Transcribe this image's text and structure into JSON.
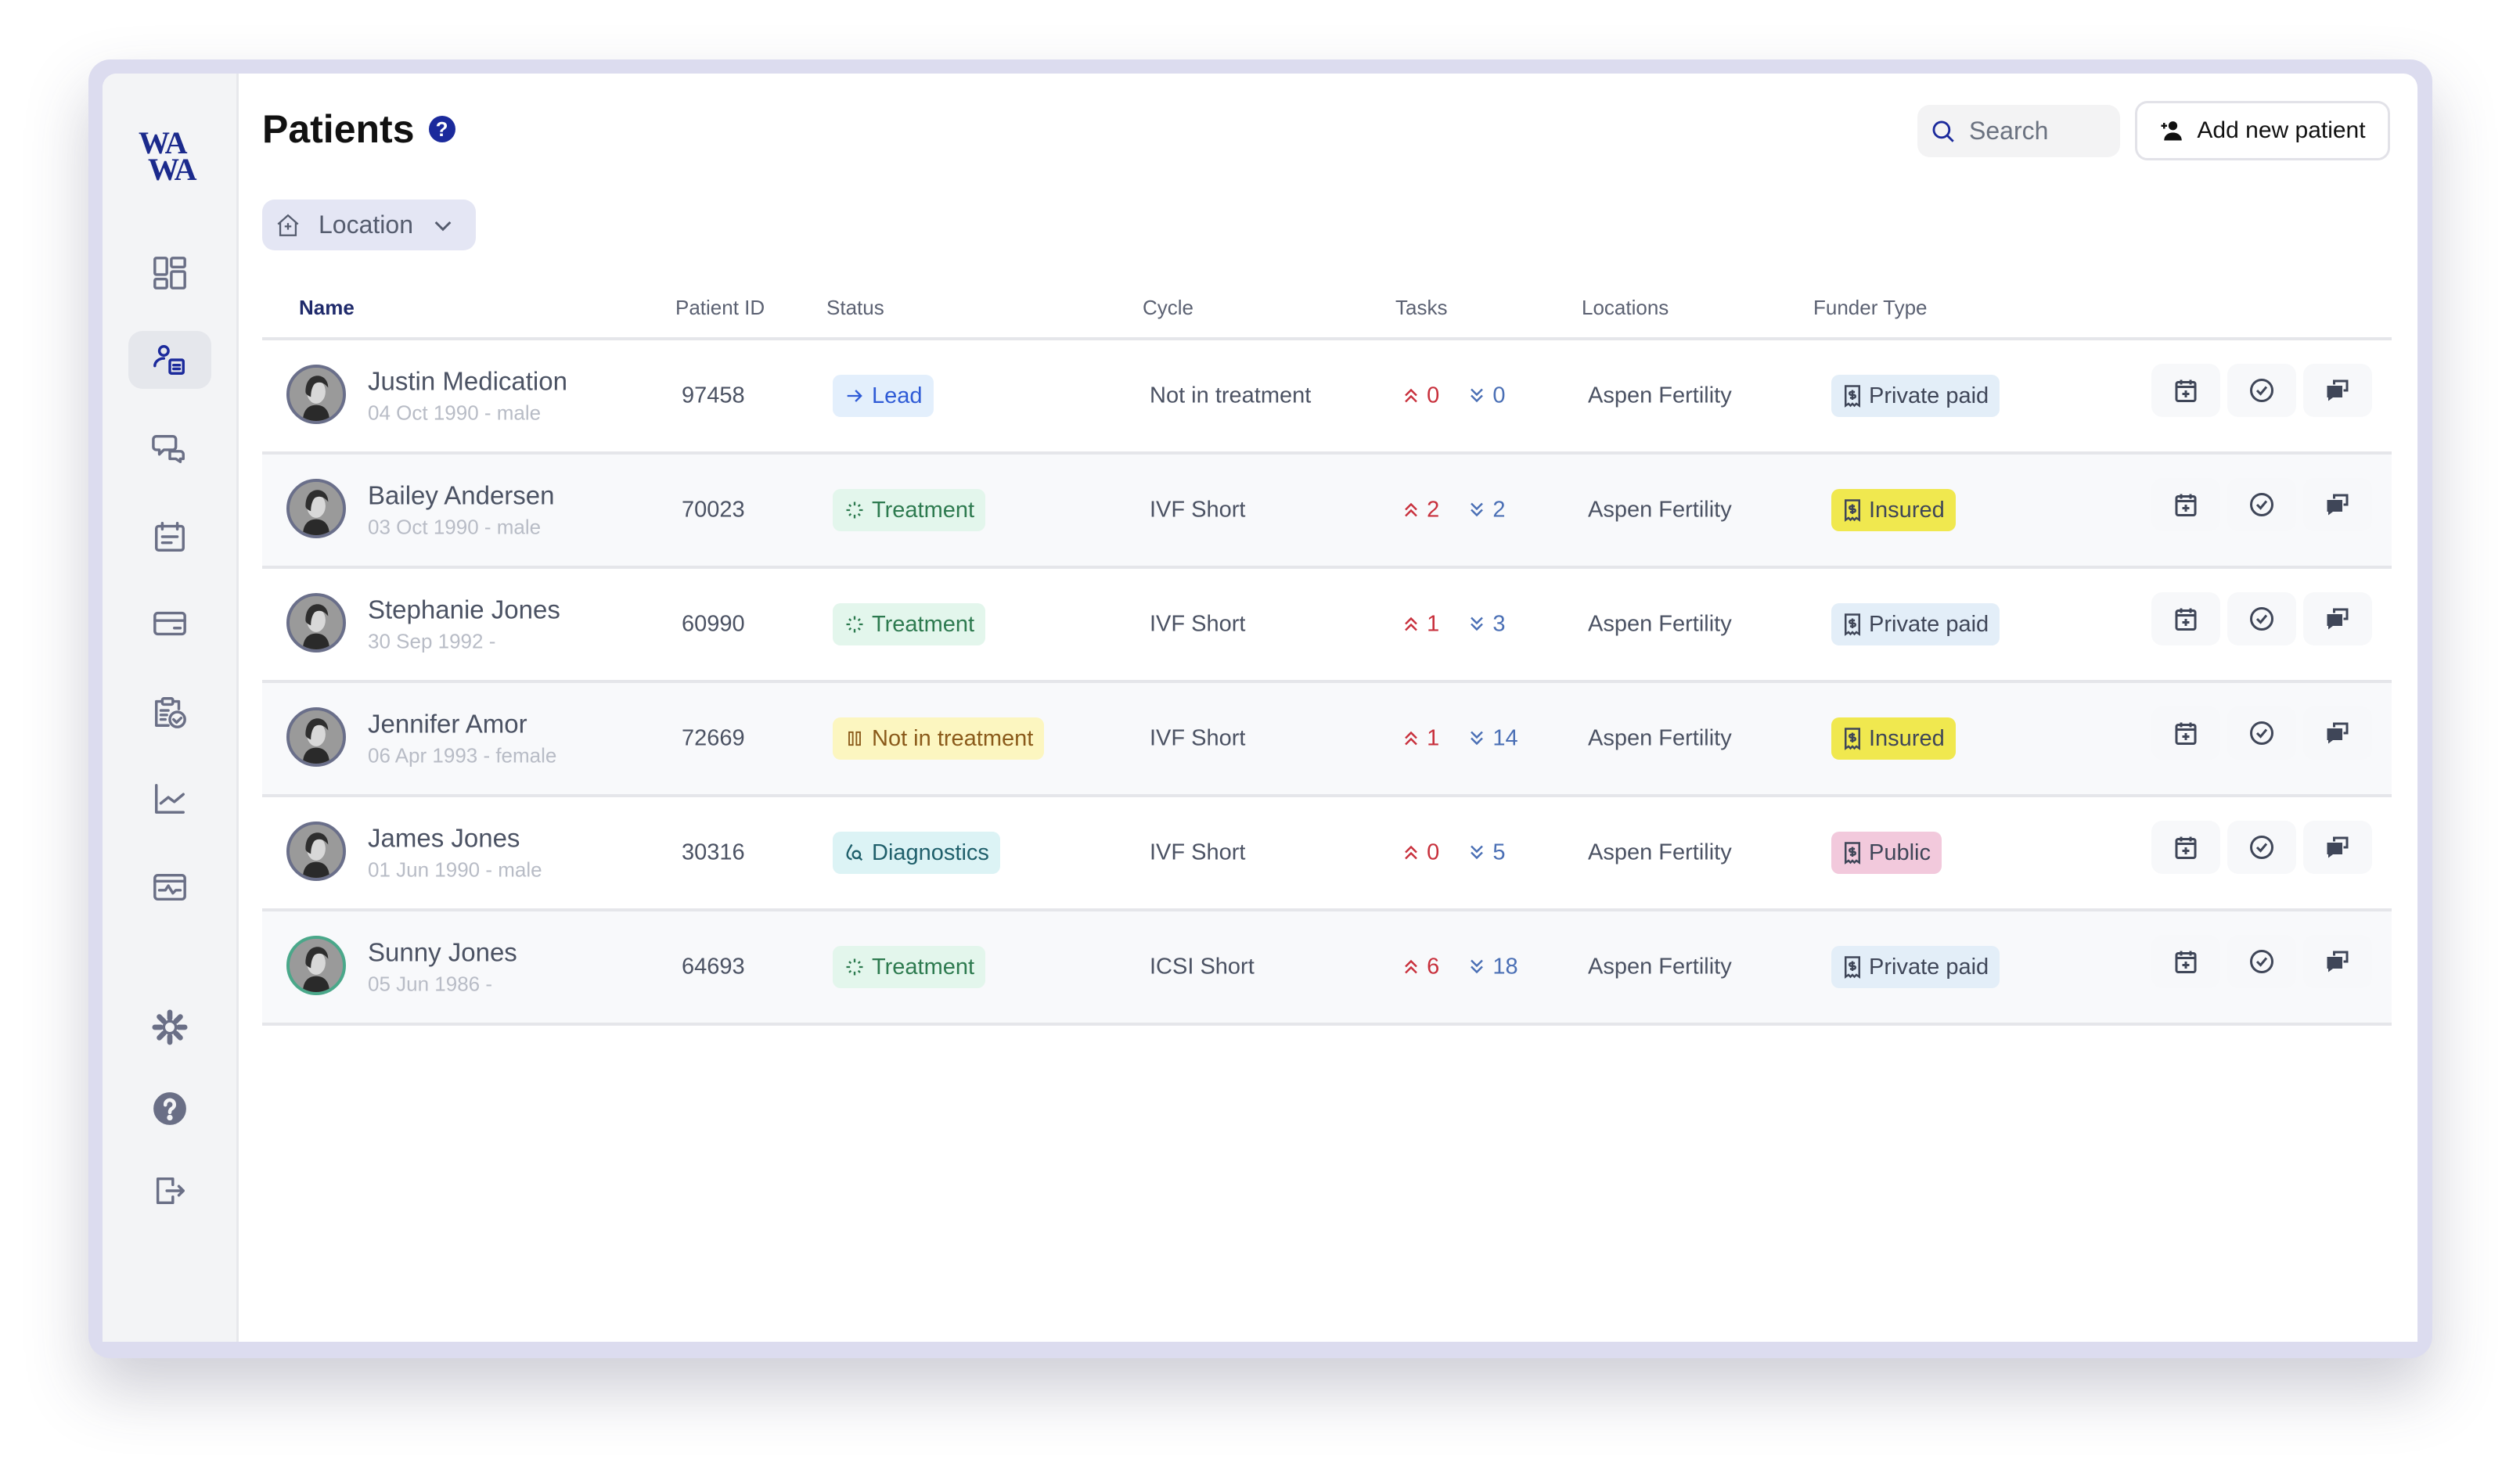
{
  "sidebar": {
    "logo": [
      "WA",
      "WA"
    ],
    "items": [
      {
        "name": "dashboard",
        "icon": "dashboard-icon"
      },
      {
        "name": "patients",
        "icon": "patients-icon",
        "active": true
      },
      {
        "name": "messages",
        "icon": "chat-icon"
      },
      {
        "name": "calendar",
        "icon": "calendar-icon"
      },
      {
        "name": "billing",
        "icon": "card-icon"
      },
      {
        "name": "tasks",
        "icon": "clipboard-check-icon"
      },
      {
        "name": "analytics",
        "icon": "chart-icon"
      },
      {
        "name": "monitoring",
        "icon": "monitor-icon"
      },
      {
        "name": "settings",
        "icon": "gear-icon"
      },
      {
        "name": "help",
        "icon": "help-icon"
      },
      {
        "name": "logout",
        "icon": "logout-icon"
      }
    ]
  },
  "header": {
    "title": "Patients",
    "help": "?",
    "search_placeholder": "Search",
    "add_label": "Add new patient"
  },
  "filter": {
    "location_label": "Location"
  },
  "table": {
    "columns": [
      "Name",
      "Patient ID",
      "Status",
      "Cycle",
      "Tasks",
      "Locations",
      "Funder Type"
    ],
    "rows": [
      {
        "name": "Justin Medication",
        "sub": "04 Oct 1990 - male",
        "id": "97458",
        "status": "Lead",
        "status_kind": "lead",
        "cycle": "Not in treatment",
        "up": "0",
        "down": "0",
        "location": "Aspen Fertility",
        "funder": "Private paid",
        "funder_kind": "private"
      },
      {
        "name": "Bailey Andersen",
        "sub": "03 Oct 1990 - male",
        "id": "70023",
        "status": "Treatment",
        "status_kind": "treatment",
        "cycle": "IVF Short",
        "up": "2",
        "down": "2",
        "location": "Aspen Fertility",
        "funder": "Insured",
        "funder_kind": "insured"
      },
      {
        "name": "Stephanie Jones",
        "sub": "30 Sep 1992 -",
        "id": "60990",
        "status": "Treatment",
        "status_kind": "treatment",
        "cycle": "IVF Short",
        "up": "1",
        "down": "3",
        "location": "Aspen Fertility",
        "funder": "Private paid",
        "funder_kind": "private"
      },
      {
        "name": "Jennifer Amor",
        "sub": "06 Apr 1993 - female",
        "id": "72669",
        "status": "Not in treatment",
        "status_kind": "paused",
        "cycle": "IVF Short",
        "up": "1",
        "down": "14",
        "location": "Aspen Fertility",
        "funder": "Insured",
        "funder_kind": "insured"
      },
      {
        "name": "James Jones",
        "sub": "01 Jun 1990 - male",
        "id": "30316",
        "status": "Diagnostics",
        "status_kind": "diagnostics",
        "cycle": "IVF Short",
        "up": "0",
        "down": "5",
        "location": "Aspen Fertility",
        "funder": "Public",
        "funder_kind": "public"
      },
      {
        "name": "Sunny Jones",
        "sub": "05 Jun 1986 -",
        "id": "64693",
        "status": "Treatment",
        "status_kind": "treatment",
        "cycle": "ICSI Short",
        "up": "6",
        "down": "18",
        "location": "Aspen Fertility",
        "funder": "Private paid",
        "funder_kind": "private",
        "highlight": true
      }
    ]
  },
  "colors": {
    "brand": "#1b2a9c",
    "lead_bg": "#e3effc",
    "lead_fg": "#2f5bd6",
    "treatment_bg": "#e3f6ec",
    "treatment_fg": "#2d7a4f",
    "paused_bg": "#fcf6c0",
    "paused_fg": "#8a5a1a",
    "diagnostics_bg": "#dcf3f5",
    "diagnostics_fg": "#1f5f6b",
    "private_bg": "#e3eef8",
    "insured_bg": "#f0e84f",
    "public_bg": "#f2c9dc",
    "task_up": "#c8303c",
    "task_down": "#4a6fb5"
  }
}
